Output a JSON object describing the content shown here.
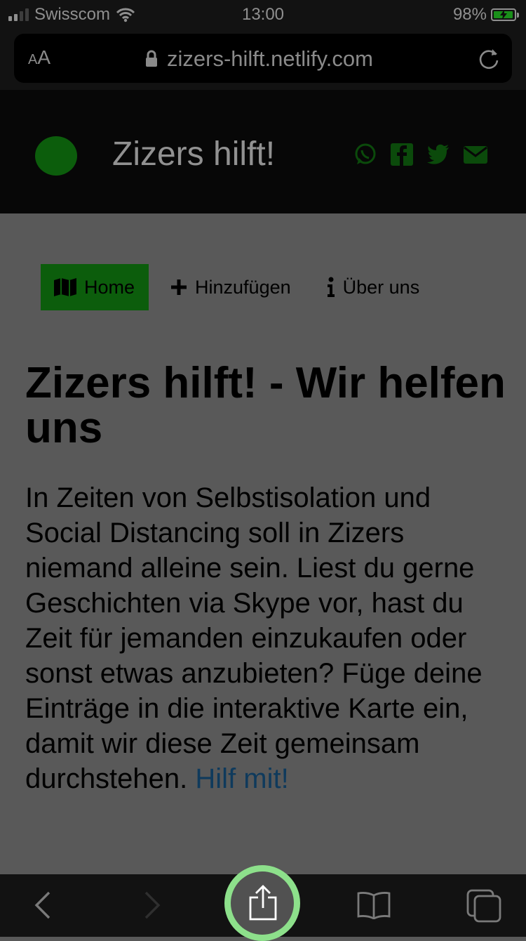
{
  "status_bar": {
    "carrier": "Swisscom",
    "time": "13:00",
    "battery_percent": "98%",
    "battery_level": 0.98,
    "signal_bars_filled": 2,
    "signal_bars_total": 4,
    "icons": [
      "wifi-icon",
      "battery-charging-icon"
    ]
  },
  "browser": {
    "text_size_label_small": "A",
    "text_size_label_large": "A",
    "url": "zizers-hilft.netlify.com",
    "icons": [
      "lock-icon",
      "reload-icon"
    ]
  },
  "site_header": {
    "title": "Zizers hilft!",
    "logo_color": "#0c5d0c",
    "social_icons": [
      "whatsapp-icon",
      "facebook-icon",
      "twitter-icon",
      "mail-icon"
    ],
    "icon_color": "#0b4a0b"
  },
  "nav": {
    "home": "Home",
    "add": "Hinzufügen",
    "about": "Über uns",
    "active_color": "#0c5d0c"
  },
  "main": {
    "heading": "Zizers hilft! - Wir helfen uns",
    "intro": "In Zeiten von Selbstisolation und Social Distancing soll in Zizers niemand alleine sein. Liest du gerne Geschichten via Skype vor, hast du Zeit für jemanden einzukaufen oder sonst etwas anzubieten? Füge deine Einträge in die interaktive Karte ein, damit wir diese Zeit gemeinsam durchstehen.",
    "cta_link": "Hilf mit!"
  },
  "toolbar": {
    "icons": [
      "back-icon",
      "forward-icon",
      "share-icon",
      "bookmarks-icon",
      "tabs-icon"
    ],
    "highlight_color": "#8de08b"
  }
}
